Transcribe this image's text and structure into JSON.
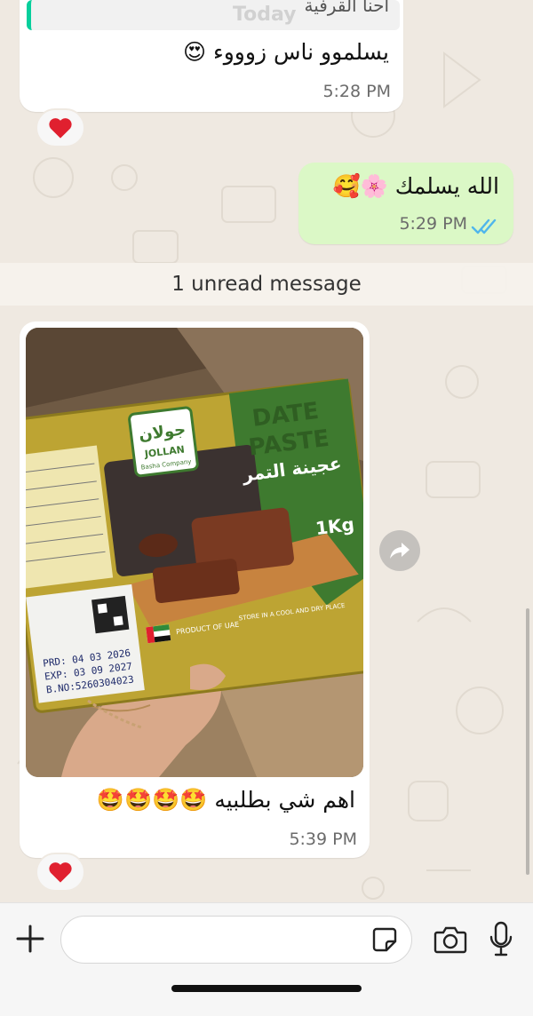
{
  "chat": {
    "messages": [
      {
        "direction": "incoming",
        "quoted_text": "احنا القرفية",
        "today_overlay": "Today",
        "text": "يسلموو ناس زوووء 😍",
        "time": "5:28 PM",
        "reaction": "heart"
      },
      {
        "direction": "outgoing",
        "text": "الله يسلمك 🌸🥰",
        "time": "5:29 PM",
        "status": "read"
      },
      {
        "direction": "incoming",
        "type": "image",
        "image_description": "Hand holding a 1Kg pack of Jollan (Basha Company) Date Paste – عجينة التمر",
        "image_label": {
          "brand_ar": "جولان",
          "brand_en": "JOLLAN",
          "company": "Basha Company",
          "product_en_1": "DATE",
          "product_en_2": "PASTE",
          "product_ar": "عجينة التمر",
          "weight": "1Kg",
          "prd": "PRD: 04 03 2026",
          "exp": "EXP: 03 09 2027",
          "batch": "B.NO:5260304023",
          "origin": "PRODUCT OF UAE",
          "storage": "STORE IN A COOL AND DRY PLACE"
        },
        "text": "اهم شي بطلبيه 🤩🤩🤩🤩",
        "time": "5:39 PM",
        "reaction": "heart"
      }
    ],
    "unread_divider": "1 unread message"
  },
  "composer": {
    "placeholder": "",
    "icons": [
      "plus-icon",
      "sticker-icon",
      "camera-icon",
      "microphone-icon"
    ]
  },
  "colors": {
    "incoming_bubble": "#ffffff",
    "outgoing_bubble": "#dbf8c6",
    "chat_background": "#efe9e1",
    "read_ticks": "#4fb6ec",
    "reaction_heart": "#e0202f",
    "quote_bar": "#06cf9c"
  }
}
